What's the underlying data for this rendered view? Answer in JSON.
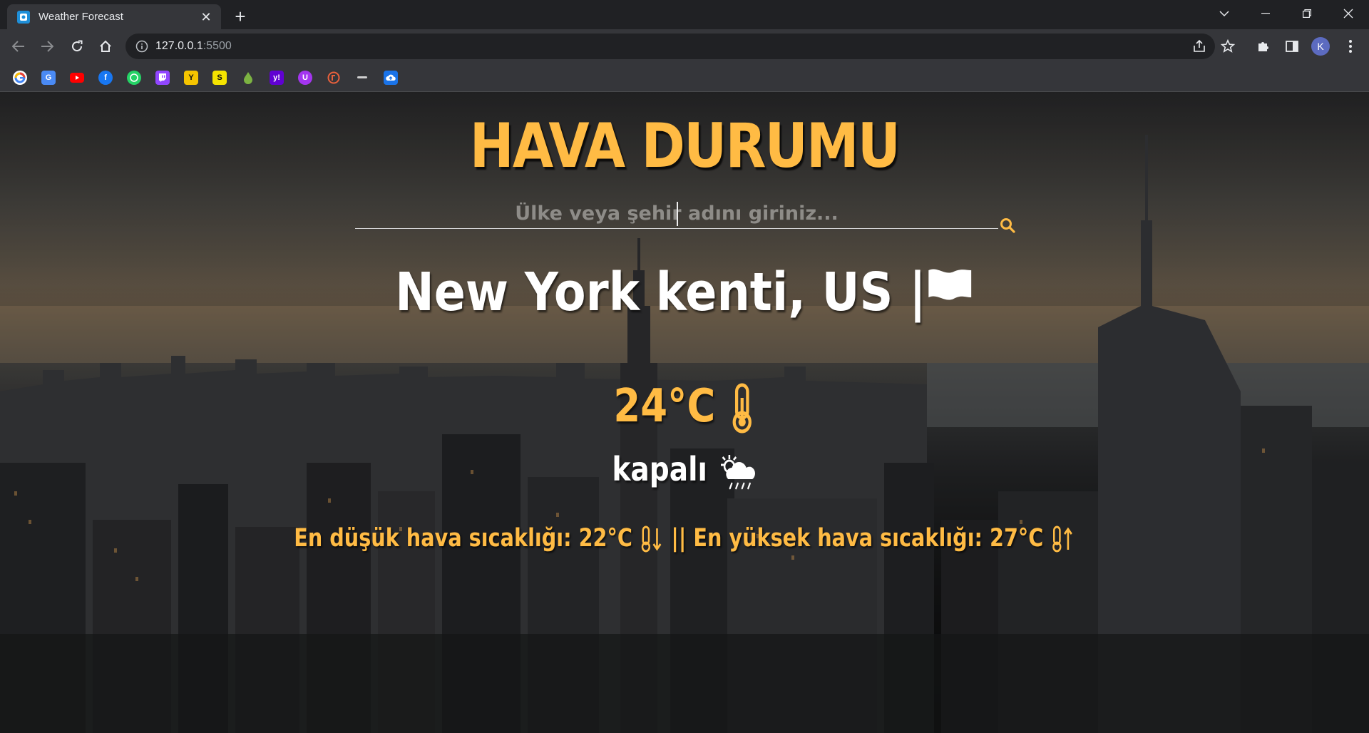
{
  "browser": {
    "tab_title": "Weather Forecast",
    "tab_close": "✕",
    "new_tab": "+",
    "url_host": "127.0.0.1",
    "url_port": ":5500",
    "avatar_letter": "K",
    "bookmarks": [
      "google-icon",
      "translate-icon",
      "youtube-icon",
      "facebook-icon",
      "whatsapp-icon",
      "twitch-icon",
      "bookmark-y-icon",
      "bookmark-s-icon",
      "drop-icon",
      "yahoo-icon",
      "udemy-icon",
      "bookmark-orange-icon",
      "dash-icon",
      "cloud-upload-icon"
    ]
  },
  "app": {
    "title": "HAVA DURUMU",
    "search_placeholder": "Ülke veya şehir adını giriniz...",
    "city_line": "New York kenti, US |",
    "temperature": "24°C",
    "description": "kapalı",
    "min_label": "En düşük hava sıcaklığı: 22°C",
    "separator": "||",
    "max_label": "En yüksek hava sıcaklığı: 27°C",
    "colors": {
      "accent": "#ffbb44",
      "text": "#ffffff"
    }
  }
}
